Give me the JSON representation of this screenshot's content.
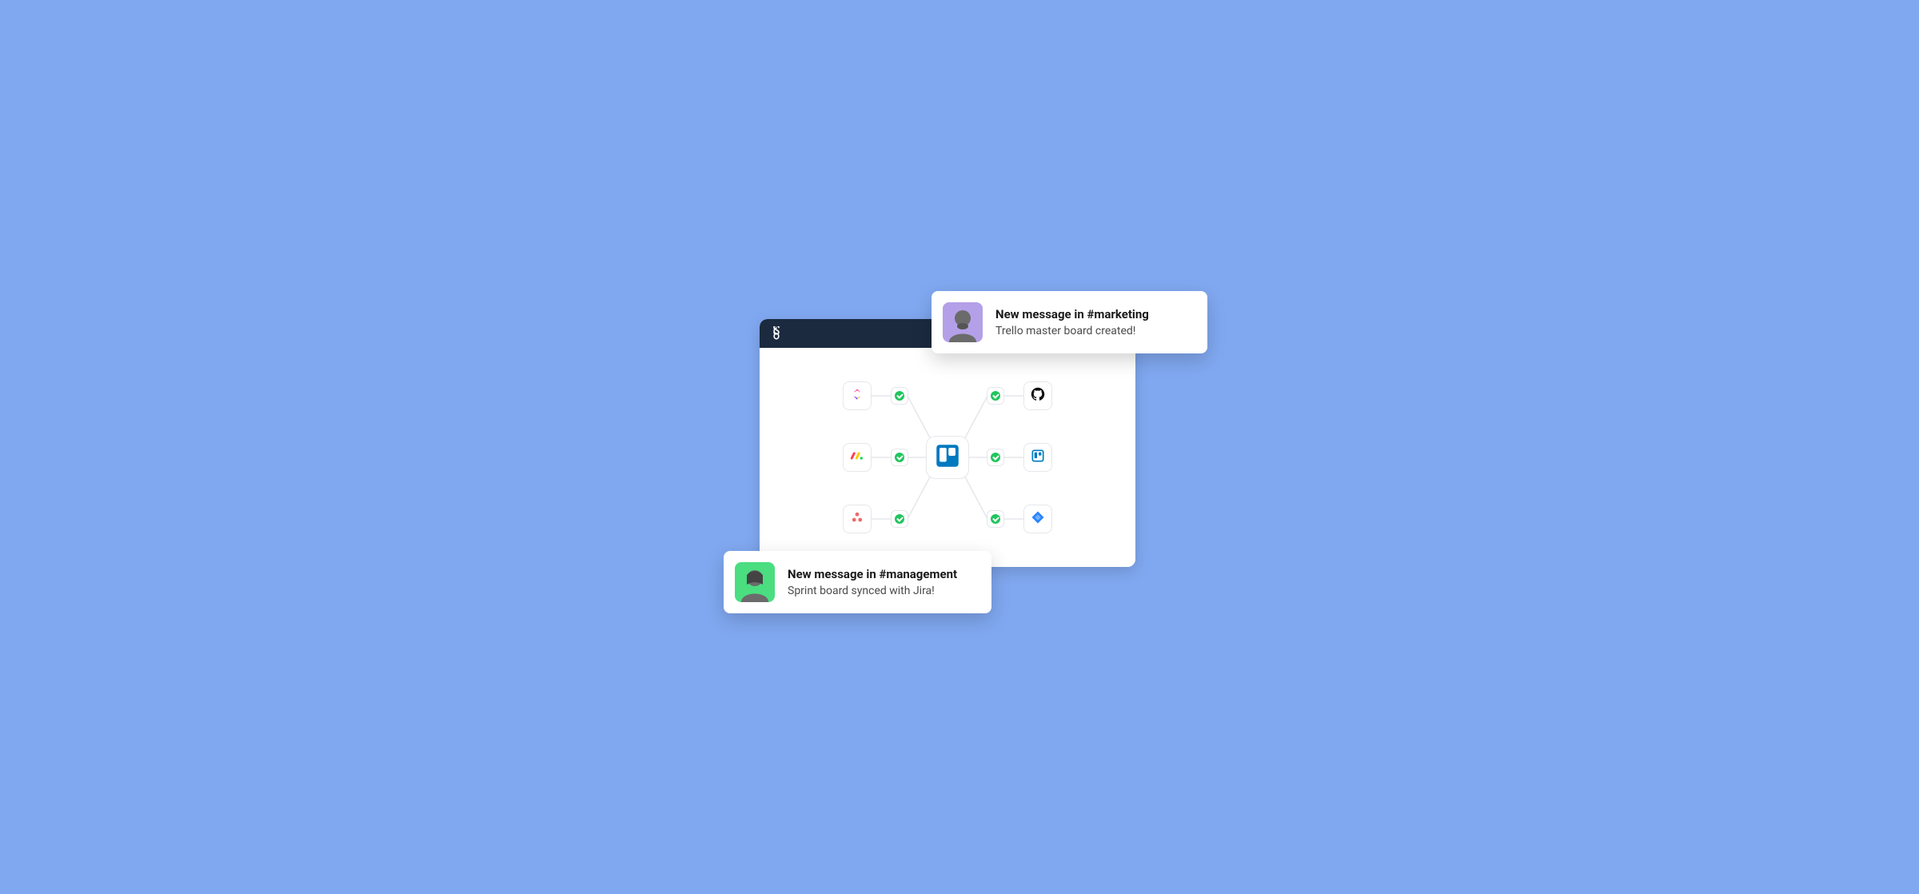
{
  "colors": {
    "background": "#80a8f0",
    "titlebar": "#1b2a3f",
    "card_border": "#e5e7eb",
    "status_green": "#22c55e",
    "trello_blue": "#0079bf",
    "jira_blue": "#2684ff"
  },
  "app_window": {
    "brand_icon": "unito-logo",
    "center_tool": {
      "name": "trello",
      "label": "Trello"
    },
    "integrations": {
      "left": [
        {
          "name": "clickup",
          "label": "ClickUp",
          "status": "synced"
        },
        {
          "name": "monday",
          "label": "monday.com",
          "status": "synced"
        },
        {
          "name": "asana",
          "label": "Asana",
          "status": "synced"
        }
      ],
      "right": [
        {
          "name": "github",
          "label": "GitHub",
          "status": "synced"
        },
        {
          "name": "trello-alt",
          "label": "Trello",
          "status": "synced"
        },
        {
          "name": "jira",
          "label": "Jira",
          "status": "synced"
        }
      ]
    }
  },
  "notifications": {
    "top": {
      "avatar_bg": "#b4a0e8",
      "title": "New message in #marketing",
      "body": "Trello master board created!"
    },
    "bottom": {
      "avatar_bg": "#4ade80",
      "title": "New message in #management",
      "body": "Sprint board synced with Jira!"
    }
  }
}
